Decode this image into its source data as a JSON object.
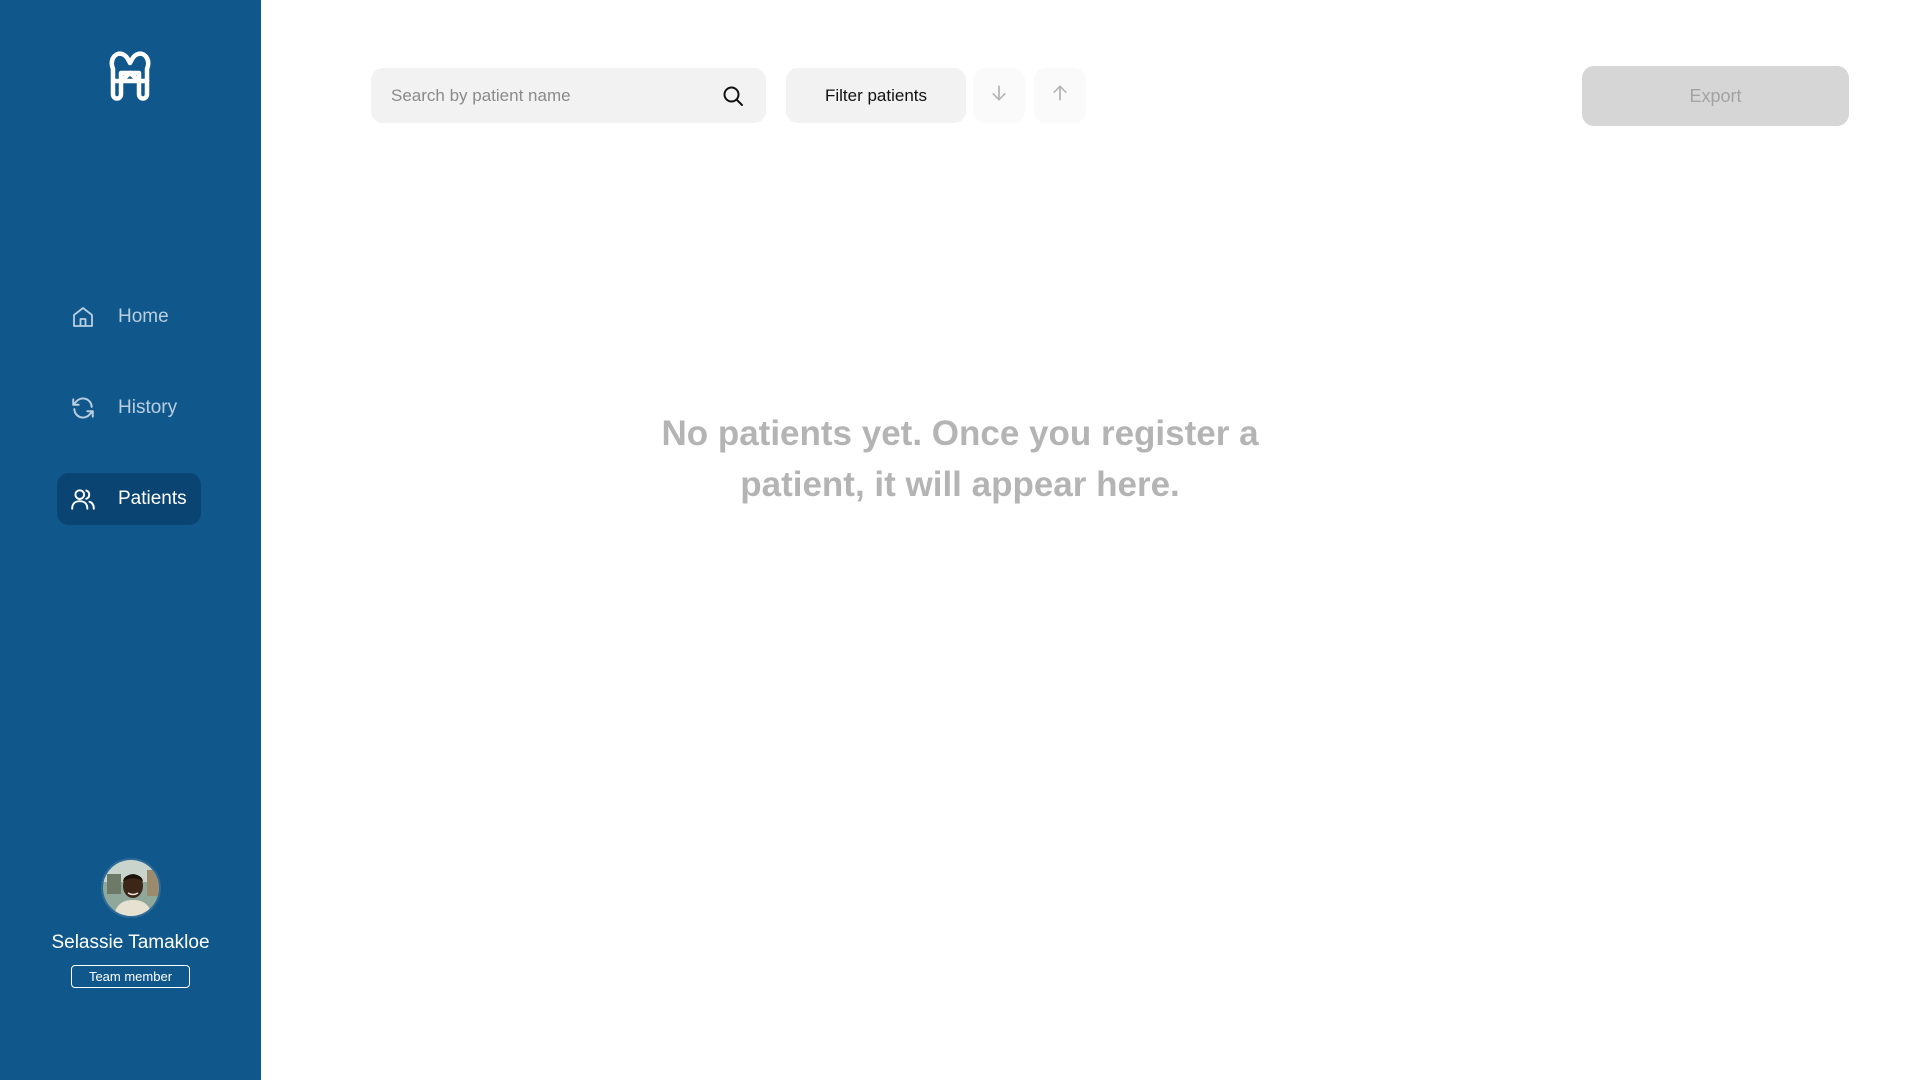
{
  "sidebar": {
    "logo_icon": "tooth-logo-icon",
    "brand_color": "#10578c",
    "active_color": "#0a4472",
    "items": [
      {
        "label": "Home",
        "icon": "home-icon",
        "active": false
      },
      {
        "label": "History",
        "icon": "refresh-icon",
        "active": false
      },
      {
        "label": "Patients",
        "icon": "users-icon",
        "active": true
      }
    ],
    "profile": {
      "name": "Selassie Tamakloe",
      "role": "Team member",
      "avatar_icon": "avatar-photo"
    }
  },
  "toolbar": {
    "search": {
      "placeholder": "Search by patient name",
      "value": "",
      "icon": "search-icon"
    },
    "filter_label": "Filter patients",
    "sort_desc_icon": "arrow-down-icon",
    "sort_asc_icon": "arrow-up-icon",
    "export_label": "Export",
    "export_disabled": true
  },
  "main": {
    "empty_message": "No patients yet. Once you register a patient, it will appear here."
  }
}
